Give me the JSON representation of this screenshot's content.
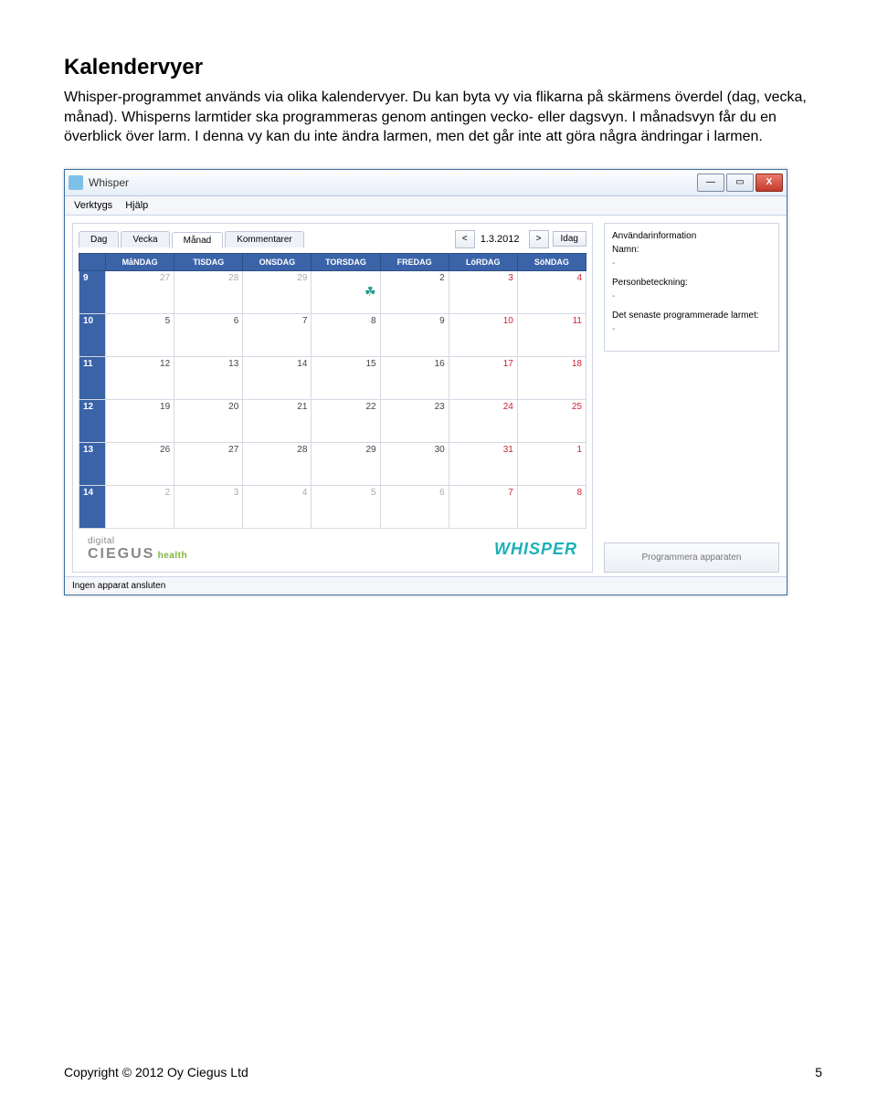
{
  "doc": {
    "heading": "Kalendervyer",
    "body": "Whisper-programmet används via olika kalendervyer. Du kan byta vy via flikarna på skärmens överdel (dag, vecka, månad). Whisperns larmtider ska programmeras genom antingen vecko- eller dagsvyn. I månadsvyn får du en överblick över larm. I denna vy kan du inte ändra larmen, men det går inte att göra några ändringar i larmen.",
    "copyright": "Copyright © 2012 Oy Ciegus Ltd",
    "page_no": "5"
  },
  "app": {
    "title": "Whisper",
    "menu": {
      "tools": "Verktygs",
      "help": "Hjälp"
    },
    "tabs": {
      "day": "Dag",
      "week": "Vecka",
      "month": "Månad",
      "comments": "Kommentarer"
    },
    "nav": {
      "prev": "<",
      "next": ">",
      "date": "1.3.2012",
      "today": "Idag"
    },
    "weekdays": {
      "mon": "MåNDAG",
      "tue": "TISDAG",
      "wed": "ONSDAG",
      "thu": "TORSDAG",
      "fri": "FREDAG",
      "sat": "LöRDAG",
      "sun": "SöNDAG"
    },
    "rows": [
      {
        "wk": "9",
        "cells": [
          "27",
          "28",
          "29",
          "",
          "2",
          "3",
          "4"
        ],
        "event_col": 3,
        "event_day": ""
      },
      {
        "wk": "10",
        "cells": [
          "5",
          "6",
          "7",
          "8",
          "9",
          "10",
          "11"
        ]
      },
      {
        "wk": "11",
        "cells": [
          "12",
          "13",
          "14",
          "15",
          "16",
          "17",
          "18"
        ]
      },
      {
        "wk": "12",
        "cells": [
          "19",
          "20",
          "21",
          "22",
          "23",
          "24",
          "25"
        ]
      },
      {
        "wk": "13",
        "cells": [
          "26",
          "27",
          "28",
          "29",
          "30",
          "31",
          "1"
        ]
      },
      {
        "wk": "14",
        "cells": [
          "2",
          "3",
          "4",
          "5",
          "6",
          "7",
          "8"
        ]
      }
    ],
    "brand": {
      "digital": "digital",
      "ciegus": "CIEGUS",
      "health": "health",
      "whisper": "WHISPER"
    },
    "userinfo": {
      "title": "Användarinformation",
      "name_lbl": "Namn:",
      "name_val": "-",
      "pid_lbl": "Personbeteckning:",
      "pid_val": "-",
      "last_lbl": "Det senaste programmerade larmet:",
      "last_val": "-"
    },
    "program_btn": "Programmera apparaten",
    "status": "Ingen apparat ansluten"
  }
}
